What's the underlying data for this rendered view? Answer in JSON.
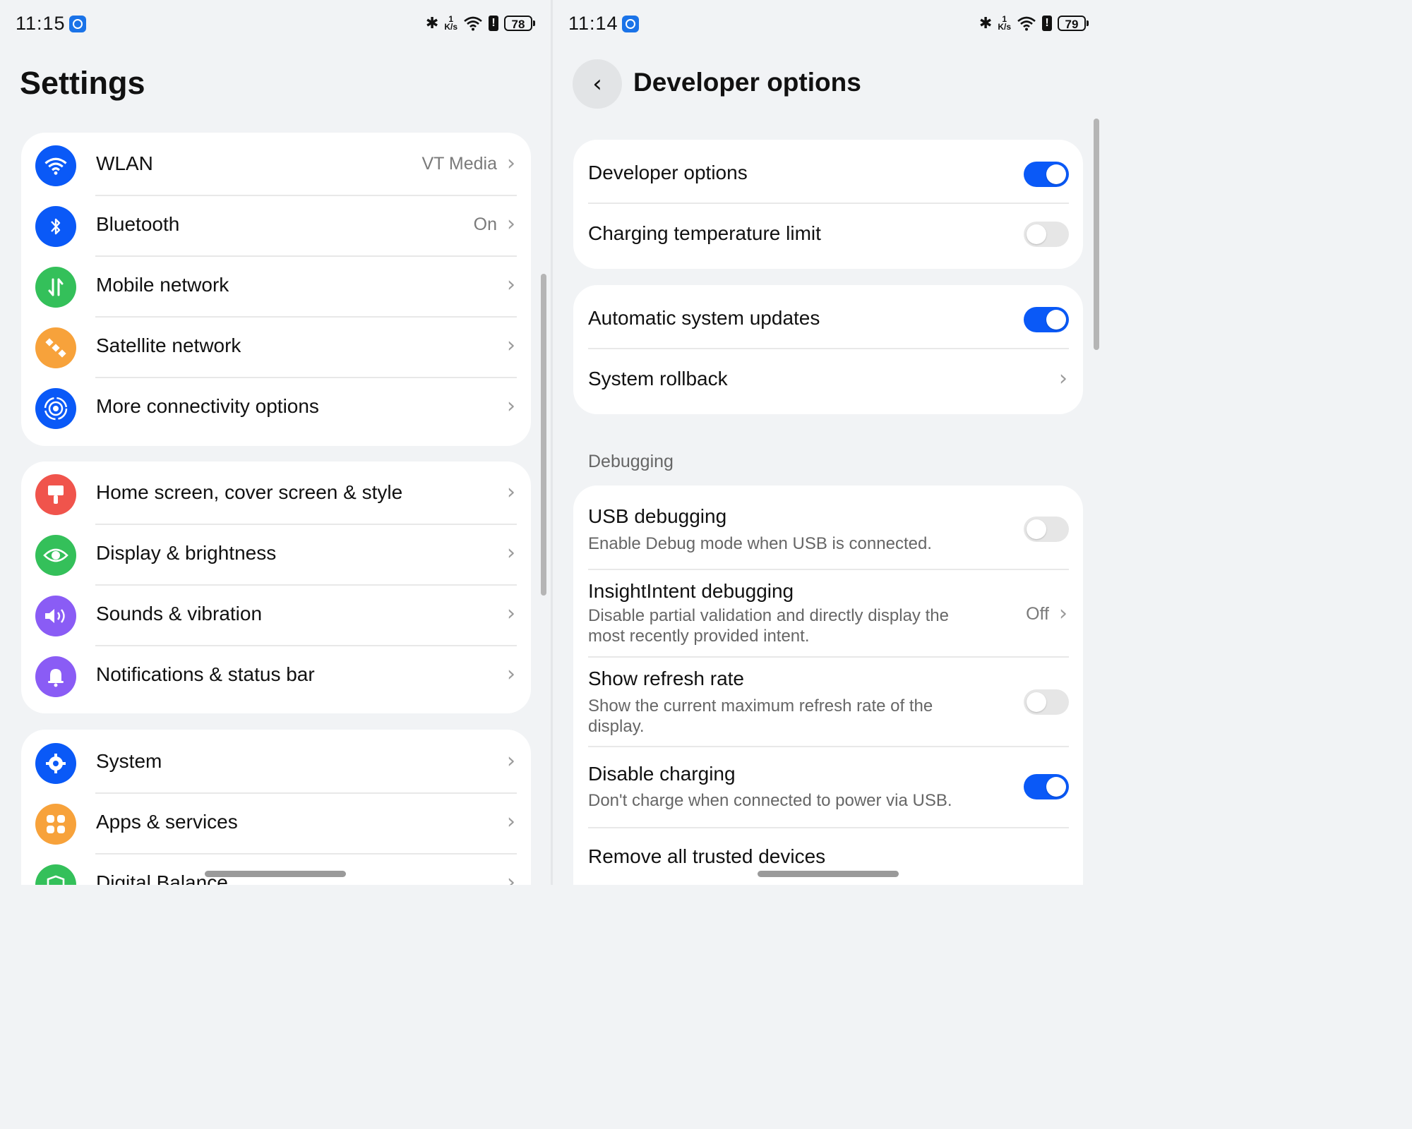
{
  "left": {
    "status": {
      "time": "11:15",
      "speed_num": "1",
      "speed_unit": "K/s",
      "battery": "78"
    },
    "title": "Settings",
    "groups": [
      [
        {
          "label": "WLAN",
          "value": "VT Media",
          "icon": "wifi-icon",
          "color": "#0a59f7"
        },
        {
          "label": "Bluetooth",
          "value": "On",
          "icon": "bluetooth-icon",
          "color": "#0a59f7"
        },
        {
          "label": "Mobile network",
          "value": "",
          "icon": "mobile-data-icon",
          "color": "#34c05a"
        },
        {
          "label": "Satellite network",
          "value": "",
          "icon": "satellite-icon",
          "color": "#f7a23b"
        },
        {
          "label": "More connectivity options",
          "value": "",
          "icon": "connectivity-icon",
          "color": "#0a59f7"
        }
      ],
      [
        {
          "label": "Home screen, cover screen & style",
          "value": "",
          "icon": "paintbrush-icon",
          "color": "#f0544c"
        },
        {
          "label": "Display & brightness",
          "value": "",
          "icon": "eye-icon",
          "color": "#34c05a"
        },
        {
          "label": "Sounds & vibration",
          "value": "",
          "icon": "speaker-icon",
          "color": "#8a5cf5"
        },
        {
          "label": "Notifications & status bar",
          "value": "",
          "icon": "bell-icon",
          "color": "#8a5cf5"
        }
      ],
      [
        {
          "label": "System",
          "value": "",
          "icon": "gear-icon",
          "color": "#0a59f7"
        },
        {
          "label": "Apps & services",
          "value": "",
          "icon": "apps-grid-icon",
          "color": "#f7a23b"
        },
        {
          "label": "Digital Balance",
          "value": "",
          "icon": "shield-heart-icon",
          "color": "#34c05a"
        }
      ]
    ]
  },
  "right": {
    "status": {
      "time": "11:14",
      "speed_num": "1",
      "speed_unit": "K/s",
      "battery": "79"
    },
    "title": "Developer options",
    "group1": [
      {
        "title": "Developer options",
        "state": "on"
      },
      {
        "title": "Charging temperature limit",
        "state": "off"
      }
    ],
    "group2": [
      {
        "title": "Automatic system updates",
        "state": "on"
      },
      {
        "title": "System rollback"
      }
    ],
    "section_debugging": "Debugging",
    "debug": [
      {
        "title": "USB debugging",
        "subtitle_1": "Enable Debug mode when USB is connected.",
        "state": "off"
      },
      {
        "title": "InsightIntent debugging",
        "subtitle_1": "Disable partial validation and directly display the",
        "subtitle_2": "most recently provided intent.",
        "value": "Off"
      },
      {
        "title": "Show refresh rate",
        "subtitle_1": "Show the current maximum refresh rate of the",
        "subtitle_2": "display.",
        "state": "off"
      },
      {
        "title": "Disable charging",
        "subtitle_1": "Don't charge when connected to power via USB.",
        "state": "on"
      },
      {
        "title": "Remove all trusted devices"
      }
    ]
  }
}
